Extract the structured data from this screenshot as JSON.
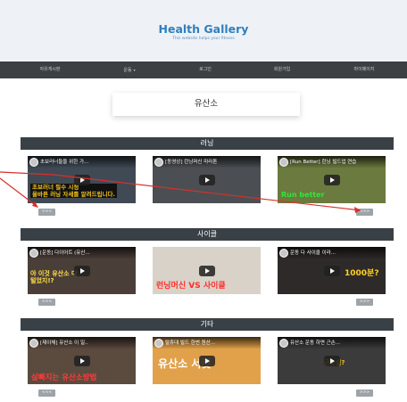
{
  "header": {
    "title": "Health Gallery",
    "subtitle": "This website helps your fitness"
  },
  "nav": {
    "items": [
      {
        "label": "자유게시판"
      },
      {
        "label": "운동"
      },
      {
        "label": "로그인"
      },
      {
        "label": "회원가입"
      },
      {
        "label": "마이페이지"
      }
    ],
    "dropdown_caret": "▾"
  },
  "page_title": "유산소",
  "sections": [
    {
      "title": "러닝",
      "videos": [
        {
          "title": "초보러너들을 위한 가...",
          "caption": "초보러너 필수 시청\n올바른 러닝 자세를 알려드립니다.",
          "bg": "#3f4a55",
          "accent": "#f2c31c"
        },
        {
          "title": "[동영상] 런닝머신 마라톤",
          "caption": "",
          "bg": "#4b4f53",
          "accent": "#ff3b3b"
        },
        {
          "title": "[Run Better] 런닝 빌드업 연습",
          "caption": "Run better",
          "bg": "#6b7a3f",
          "accent": "#36e23a"
        }
      ],
      "prev_label": "<<<",
      "next_label": ">>>"
    },
    {
      "title": "사이클",
      "videos": [
        {
          "title": "[운동] 다이어트 (유산...",
          "caption": "야 이것 유산소 다 털었지!?",
          "bg": "#4a3e38",
          "accent": "#ffe14a"
        },
        {
          "title": "",
          "caption": "런닝머신 VS 사이클",
          "bg": "#d9d2c8",
          "accent": "#ff2d2d"
        },
        {
          "title": "운동 다 사이클 이라...",
          "caption": "1000분?",
          "bg": "#2f2a2a",
          "accent": "#ffd21f"
        }
      ],
      "prev_label": "<<<",
      "next_label": ">>>"
    },
    {
      "title": "기타",
      "videos": [
        {
          "title": "[제이체] 유산소 이 일..",
          "caption": "살빠지는 유산소방법",
          "bg": "#5b4a3e",
          "accent": "#ff3b3b"
        },
        {
          "title": "탈휴대 빌드 한번 원산...",
          "caption": "유산소 서킷",
          "bg": "#e1a14a",
          "accent": "#ffffff"
        },
        {
          "title": "유산소 운동 하면 근손...",
          "caption": "근손실?",
          "bg": "#3b3b3b",
          "accent": "#f2c31c"
        }
      ],
      "prev_label": "<<<",
      "next_label": ">>>"
    }
  ],
  "colors": {
    "header_bg": "#eef2f6",
    "title_blue": "#2f7fbf",
    "navbar_bg": "#3c4043",
    "section_bar_bg": "#3a4146",
    "annotation_red": "#d9302c"
  }
}
